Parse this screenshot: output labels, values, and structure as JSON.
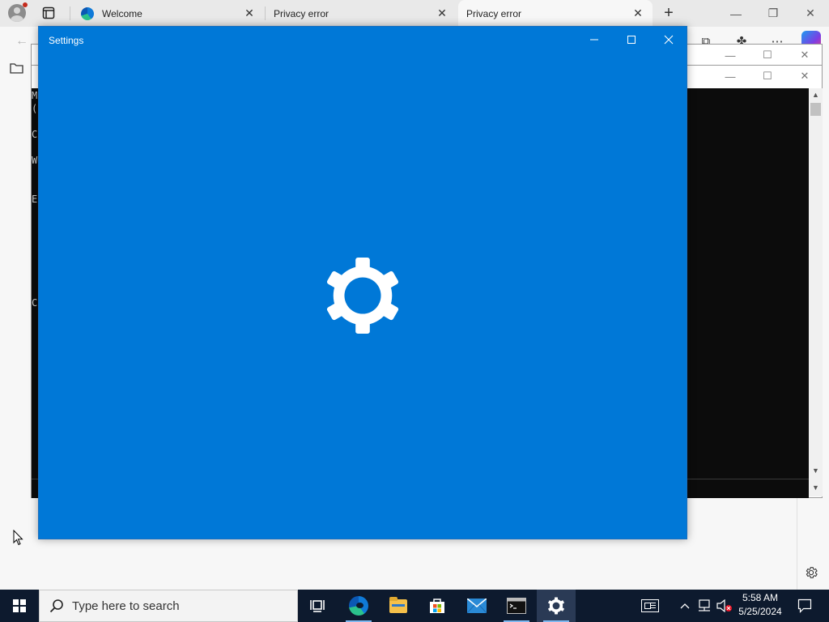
{
  "browser": {
    "tabs": [
      {
        "label": "Welcome",
        "icon": "edge-icon"
      },
      {
        "label": "Privacy error",
        "icon": ""
      },
      {
        "label": "Privacy error",
        "icon": ""
      }
    ],
    "new_tab_symbol": "+"
  },
  "console": {
    "lines": [
      "M",
      "(",
      "C",
      "W",
      "E",
      "C"
    ]
  },
  "settings_window": {
    "title": "Settings",
    "background": "#0078d7",
    "splash_icon": "gear-icon"
  },
  "taskbar": {
    "search_placeholder": "Type here to search",
    "apps": [
      "task-view-icon",
      "edge-icon",
      "file-explorer-icon",
      "store-icon",
      "mail-icon",
      "cmd-icon",
      "settings-gear-icon"
    ],
    "active_app": "settings-gear-icon",
    "clock": {
      "time": "5:58 AM",
      "date": "5/25/2024"
    }
  }
}
